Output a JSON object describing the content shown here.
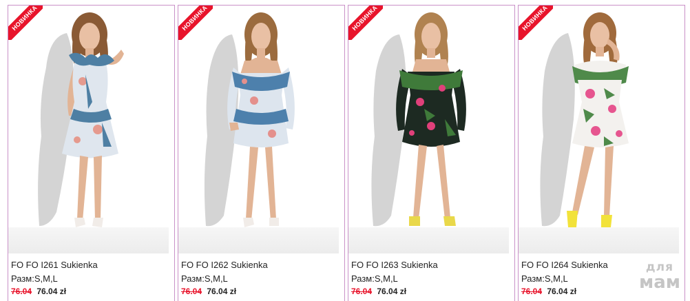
{
  "products": [
    {
      "badge": "НОВИНКА",
      "title": "FO FO I261 Sukienka",
      "sizes": "Разм:S,M,L",
      "old_price": "76.04",
      "price": "76.04 zł",
      "dress_colors": {
        "base": "#dfe6ee",
        "print": "#4e7fa3",
        "accent": "#e59a8e"
      },
      "shoe_color": "#f1ece8"
    },
    {
      "badge": "НОВИНКА",
      "title": "FO FO I262 Sukienka",
      "sizes": "Разм:S,M,L",
      "old_price": "76.04",
      "price": "76.04 zł",
      "dress_colors": {
        "base": "#dde5ee",
        "print": "#4d80ac",
        "accent": "#e4908c"
      },
      "shoe_color": "#f1ece8"
    },
    {
      "badge": "НОВИНКА",
      "title": "FO FO I263 Sukienka",
      "sizes": "Разм:S,M,L",
      "old_price": "76.04",
      "price": "76.04 zł",
      "dress_colors": {
        "base": "#1d2a22",
        "print": "#3f7a3a",
        "accent": "#e0407a"
      },
      "shoe_color": "#e9d84a"
    },
    {
      "badge": "НОВИНКА",
      "title": "FO FO I264 Sukienka",
      "sizes": "Разм:S,M,L",
      "old_price": "76.04",
      "price": "76.04 zł",
      "dress_colors": {
        "base": "#f3f1ee",
        "print": "#4f8a4a",
        "accent": "#e6558f"
      },
      "shoe_color": "#f2e23a"
    }
  ],
  "watermark": {
    "top": "для",
    "bottom": "мам"
  },
  "colors": {
    "border": "#c990c8",
    "badge": "#e8142b",
    "old_price": "#e8142b"
  }
}
